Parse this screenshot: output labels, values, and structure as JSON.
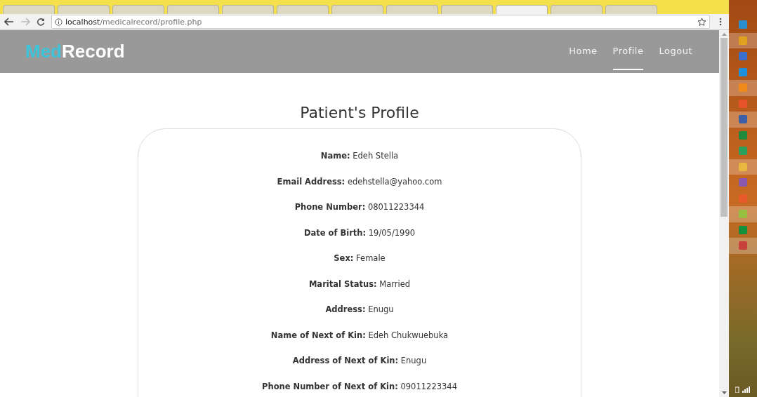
{
  "browser": {
    "tabs": [
      {
        "selected": false
      },
      {
        "selected": false
      },
      {
        "selected": false
      },
      {
        "selected": false
      },
      {
        "selected": false
      },
      {
        "selected": false
      },
      {
        "selected": false
      },
      {
        "selected": false
      },
      {
        "selected": false
      },
      {
        "selected": true
      },
      {
        "selected": false
      },
      {
        "selected": false
      }
    ],
    "back_enabled": true,
    "forward_enabled": false,
    "url_host": "localhost",
    "url_path": "/medicalrecord/profile.php"
  },
  "navbar": {
    "logo": [
      "Med",
      "Record"
    ],
    "items": [
      {
        "label": "Home",
        "selected": false
      },
      {
        "label": "Profile",
        "selected": true
      },
      {
        "label": "Logout",
        "selected": false
      }
    ]
  },
  "page_title": "Patient's Profile",
  "fields": [
    "**Name:** Edeh Stella",
    "**Email Address:** edehstella@yahoo.com",
    "**Phone Number:** 08011223344",
    "**Date of Birth:** 19/05/1990",
    "**Sex:** Female",
    "**Marital Status:** Married",
    "**Address:** Enugu",
    "**Name of Next of Kin:** Edeh Chukwuebuka",
    "**Address of Next of Kin:** Enugu",
    "**Phone Number of Next of Kin:** 09011223344"
  ],
  "taskbar": [
    {
      "color": "#2a8fd0",
      "active": false
    },
    {
      "color": "#e0a020",
      "active": true
    },
    {
      "color": "#3a6fd0",
      "active": false
    },
    {
      "color": "#1e90e0",
      "active": false
    },
    {
      "color": "#f08a1a",
      "active": true
    },
    {
      "color": "#e8542a",
      "active": false
    },
    {
      "color": "#3d5fa8",
      "active": true
    },
    {
      "color": "#1f8a3c",
      "active": false
    },
    {
      "color": "#2aa05a",
      "active": false
    },
    {
      "color": "#e8b840",
      "active": true
    },
    {
      "color": "#8a5ab0",
      "active": false
    },
    {
      "color": "#e85a2a",
      "active": false
    },
    {
      "color": "#98c040",
      "active": true
    },
    {
      "color": "#12903c",
      "active": false
    },
    {
      "color": "#c8403a",
      "active": true
    }
  ]
}
